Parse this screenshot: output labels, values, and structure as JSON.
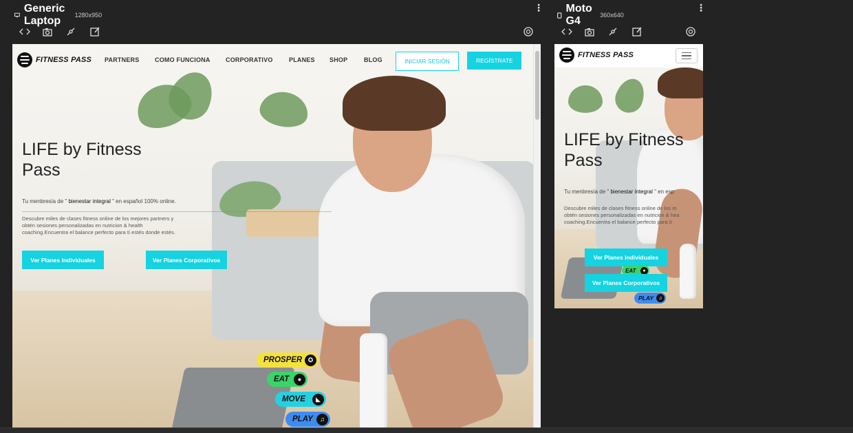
{
  "laptop": {
    "device_name": "Generic Laptop",
    "dims": "1280x950",
    "site": {
      "logo_text": "FITNESS PASS",
      "nav": [
        "PARTNERS",
        "COMO FUNCIONA",
        "CORPORATIVO",
        "PLANES",
        "SHOP",
        "BLOG"
      ],
      "login_label": "INICIAR SESIÓN",
      "register_label": "REGÍSTRATE",
      "title_strong": "LIFE",
      "title_rest": " by Fitness",
      "title_line2": "Pass",
      "subtitle_pre": "Tu menbresía de \"",
      "subtitle_em": " bienestar integral ",
      "subtitle_post": "\" en español 100% online.",
      "desc_line1": "Descubre miles de clases fitness online de los mejores partners y",
      "desc_line2": "obtén sesiones personalizadas en nutricion & health",
      "desc_line3": "coaching.Encuentra el balance perfecto para tí estés donde estés.",
      "cta_individual": "Ver Planes Individuales",
      "cta_corporate": "Ver Planes Corporativos",
      "pills": [
        {
          "label": "PROSPER",
          "icon": "award-icon",
          "color": "#f4e23c"
        },
        {
          "label": "EAT",
          "icon": "apple-icon",
          "color": "#3bd46a"
        },
        {
          "label": "MOVE",
          "icon": "shoe-icon",
          "color": "#25d1e0"
        },
        {
          "label": "PLAY",
          "icon": "music-icon",
          "color": "#3f8cf0"
        }
      ]
    }
  },
  "mobile": {
    "device_name": "Moto G4",
    "dims": "360x640",
    "site": {
      "logo_text": "FITNESS PASS",
      "title_strong": "LIFE",
      "title_rest": " by Fitness",
      "title_line2": "Pass",
      "subtitle_pre": "Tu menbresía de \"",
      "subtitle_em": " bienestar integral ",
      "subtitle_post": "\" en esp",
      "desc_line1": "Descubre miles de clases fitness online de los m",
      "desc_line2": "obtén sesiones personalizadas en nutricion & hea",
      "desc_line3": "coaching.Encuentra el balance perfecto para tí",
      "cta_individual": "Ver Planes Individuales",
      "cta_corporate": "Ver Planes Corporativos",
      "pill_eat": "EAT",
      "pill_play": "PLAY"
    }
  },
  "colors": {
    "accent": "#15d3e0",
    "background": "#232323"
  }
}
